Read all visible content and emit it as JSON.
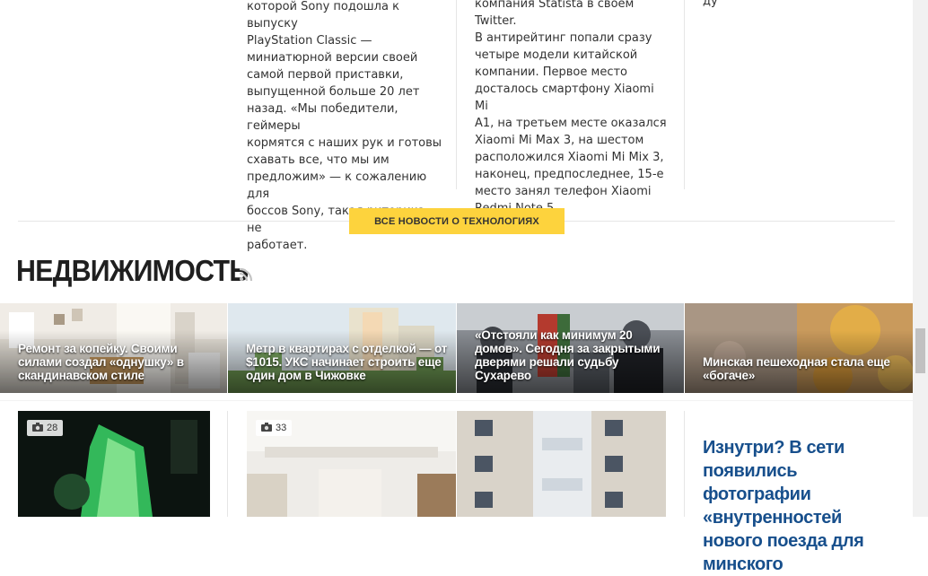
{
  "tech_column1_lines": [
    "которой Sony подошла к выпуску",
    "PlayStation Classic —",
    "миниатюрной версии своей",
    "самой первой приставки,",
    "выпущенной больше 20 лет",
    "назад. «Мы победители, геймеры",
    "кормятся с наших рук и готовы",
    "схавать все, что мы им",
    "предложим» — к сожалению для",
    "боссов Sony, такая риторика не",
    "работает."
  ],
  "tech_column2_lines": [
    "компания Statista в своем Twitter.",
    "В антирейтинг попали сразу",
    "четыре модели китайской",
    "компании. Первое место",
    "досталось смартфону Xiaomi Mi",
    "A1, на третьем месте оказался",
    "Xiaomi Mi Max 3, на шестом",
    "расположился Xiaomi Mi Mix 3,",
    "наконец, предпоследнее, 15-е",
    "место занял телефон Xiaomi",
    "Redmi Note 5."
  ],
  "tech_column3_fragment": "ду",
  "all_tech_button": "ВСЕ НОВОСТИ О ТЕХНОЛОГИЯХ",
  "section_title": "НЕДВИЖИМОСТЬ",
  "tiles": [
    {
      "caption": "Ремонт за копейку. Своими силами создал «однушку» в скандинавском стиле"
    },
    {
      "caption": "Метр в квартирах с отделкой — от $1015. УКС начинает строить еще один дом в Чижовке"
    },
    {
      "caption": "«Отстояли как минимум 20 домов». Сегодня за закрытыми дверями решали судьбу Сухарево"
    },
    {
      "caption": "Минская пешеходная стала еще «богаче»"
    }
  ],
  "cards": [
    {
      "photo_count": "28"
    },
    {
      "photo_count": "33"
    }
  ],
  "article_link": "Изнутри? В сети появились фотографии «внутренностей нового поезда для минского",
  "colors": {
    "accent": "#fdd33d",
    "link": "#174f8c"
  }
}
